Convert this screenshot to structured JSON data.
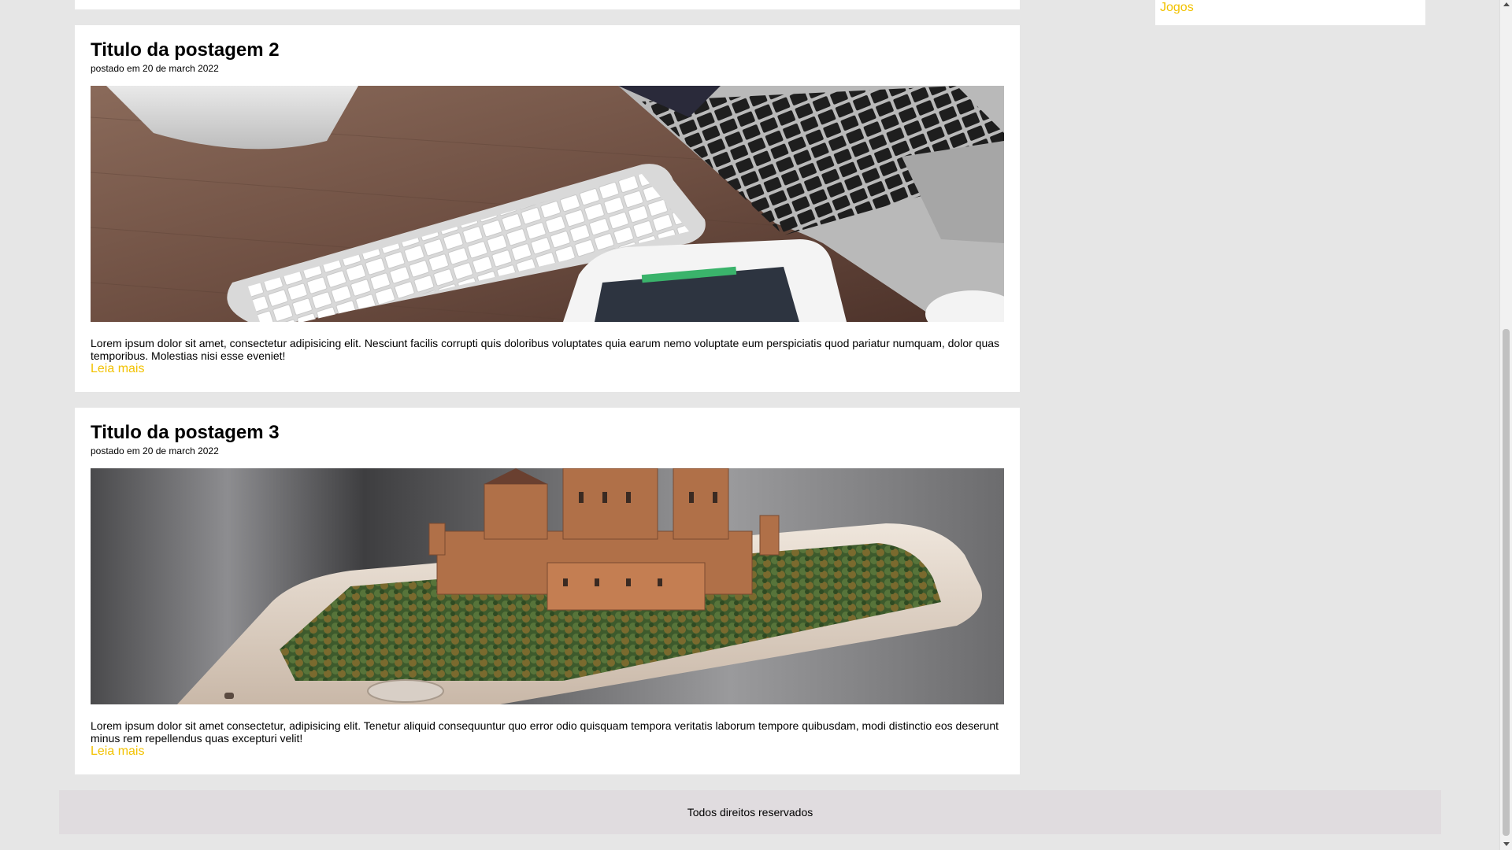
{
  "sidebar": {
    "link_label": "Jogos"
  },
  "posts": [
    {
      "title": "Titulo da postagem 2",
      "meta": "postado em 20 de march 2022",
      "image_subject": "desk-with-keyboard-laptop-tablet",
      "text": "Lorem ipsum dolor sit amet, consectetur adipisicing elit. Nesciunt facilis corrupti quis doloribus voluptates quia earum nemo voluptate eum perspiciatis quod pariatur numquam, dolor quas temporibus. Molestias nisi esse eveniet!",
      "read_more": "Leia mais"
    },
    {
      "title": "Titulo da postagem 3",
      "meta": "postado em 20 de march 2022",
      "image_subject": "castle-on-smartphone",
      "text": "Lorem ipsum dolor sit amet consectetur, adipisicing elit. Tenetur aliquid consequuntur quo error odio quisquam tempora veritatis laborum tempore quibusdam, modi distinctio eos deserunt minus rem repellendus quas excepturi velit!",
      "read_more": "Leia mais"
    }
  ],
  "footer": {
    "text": "Todos direitos reservados"
  },
  "colors": {
    "page_background": "#e6e6e6",
    "card_background": "#ffffff",
    "link_accent": "#f2c200",
    "footer_background": "#e0dcdf"
  }
}
